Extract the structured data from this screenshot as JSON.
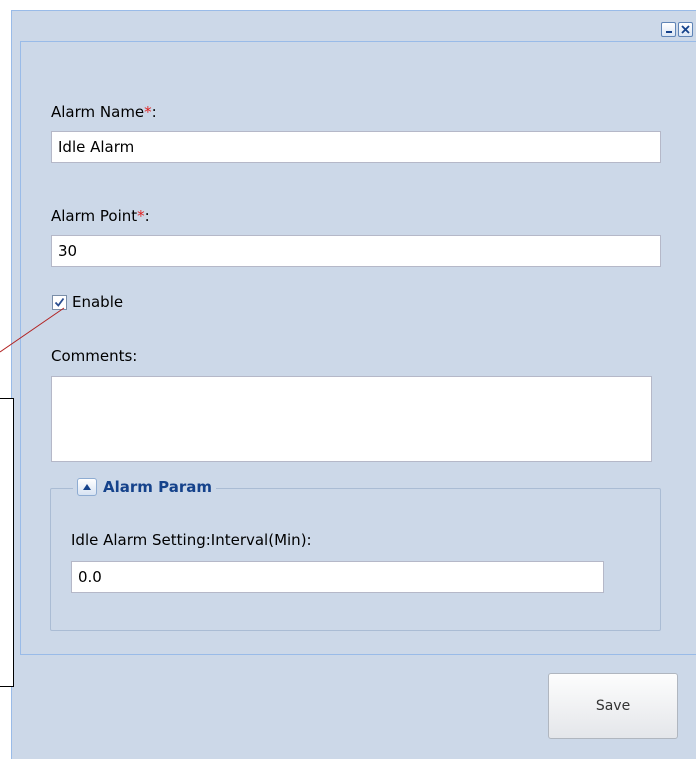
{
  "form": {
    "alarm_name": {
      "label": "Alarm Name",
      "required_mark": "*",
      "colon": ":",
      "value": "Idle Alarm"
    },
    "alarm_point": {
      "label": "Alarm Point",
      "required_mark": "*",
      "colon": ":",
      "value": "30"
    },
    "enable": {
      "label": "Enable",
      "checked": true
    },
    "comments": {
      "label": "Comments:",
      "value": ""
    },
    "alarm_param": {
      "legend": "Alarm Param",
      "interval_label": "Idle Alarm Setting:Interval(Min):",
      "interval_value": "0.0"
    }
  },
  "buttons": {
    "save_label": "Save"
  },
  "window_tools": {
    "minimize_icon": "minimize-icon",
    "close_icon": "close-icon"
  },
  "colors": {
    "panel_bg": "#ccd8e8",
    "required": "#e02020",
    "legend_text": "#15428b",
    "callout_line": "#b22222"
  }
}
